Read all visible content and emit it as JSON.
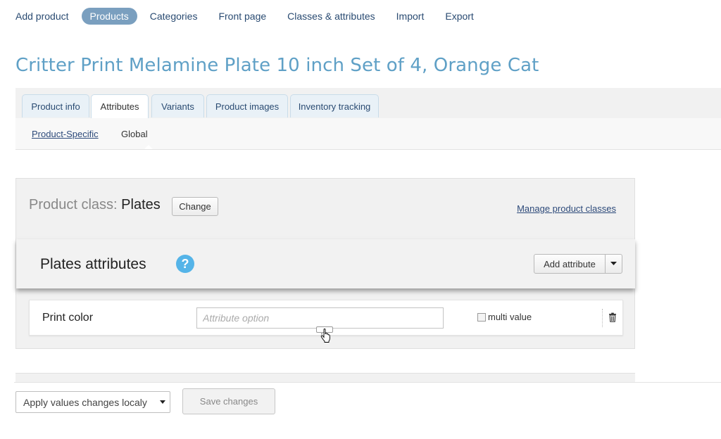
{
  "topnav": {
    "items": [
      {
        "label": "Add product",
        "active": false
      },
      {
        "label": "Products",
        "active": true
      },
      {
        "label": "Categories",
        "active": false
      },
      {
        "label": "Front page",
        "active": false
      },
      {
        "label": "Classes & attributes",
        "active": false
      },
      {
        "label": "Import",
        "active": false
      },
      {
        "label": "Export",
        "active": false
      }
    ]
  },
  "page": {
    "title": "Critter Print Melamine Plate 10 inch Set of 4, Orange Cat"
  },
  "tabs": [
    {
      "label": "Product info",
      "active": false
    },
    {
      "label": "Attributes",
      "active": true
    },
    {
      "label": "Variants",
      "active": false
    },
    {
      "label": "Product images",
      "active": false
    },
    {
      "label": "Inventory tracking",
      "active": false
    }
  ],
  "subtabs": [
    {
      "label": "Product-Specific",
      "active": false
    },
    {
      "label": "Global",
      "active": true
    }
  ],
  "product_class": {
    "label": "Product class:",
    "value": "Plates",
    "change_label": "Change",
    "manage_label": "Manage product classes"
  },
  "attributes_section": {
    "title": "Plates attributes",
    "help_glyph": "?",
    "add_label": "Add attribute",
    "attribute": {
      "name": "Print color",
      "option_placeholder": "Attribute option",
      "option_value": "",
      "multi_value_label": "multi value",
      "multi_value_checked": false
    }
  },
  "bottom": {
    "apply_select_value": "Apply values changes localy",
    "save_label": "Save changes",
    "save_enabled": false
  },
  "icons": {
    "help": "question-circle-icon",
    "dropdown": "caret-down-icon",
    "delete": "trash-icon",
    "cursor": "hand-pointer-icon",
    "resize": "resize-handle-icon"
  },
  "colors": {
    "title": "#5fa0c6",
    "nav_active_bg": "#7a9fbf",
    "link": "#2d4a7a",
    "help_bg": "#55b4e8"
  }
}
